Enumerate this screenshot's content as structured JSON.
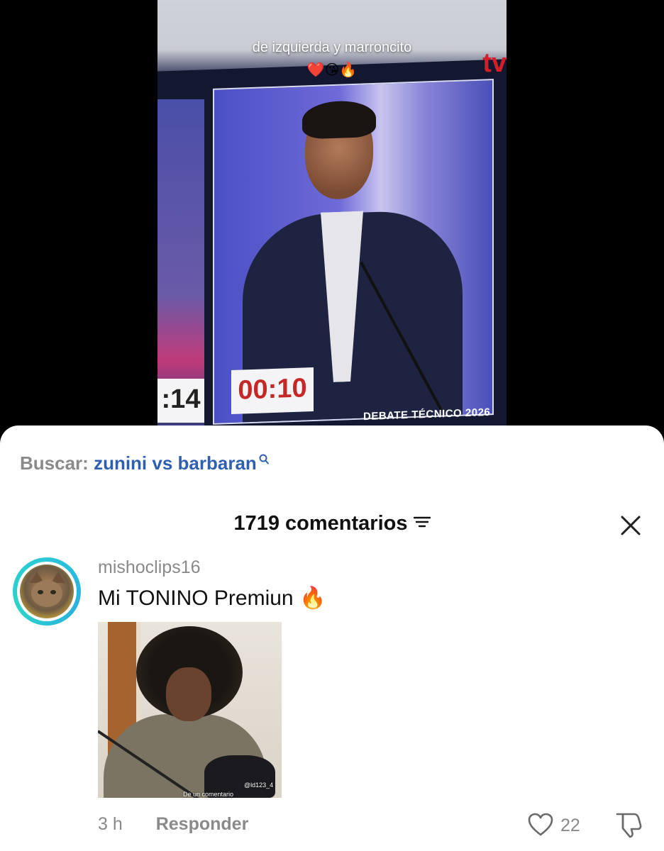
{
  "video": {
    "overlay_caption": "de izquierda y marroncito",
    "overlay_emojis": "❤️😘🔥",
    "channel_logo": "tv",
    "timer_left": ":14",
    "timer_main": "00:10",
    "banner": "DEBATE TÉCNICO 2026"
  },
  "search": {
    "prefix": "Buscar:",
    "term": "zunini vs barbaran",
    "icon": "search-icon"
  },
  "comments_panel": {
    "header": "1719 comentarios",
    "filter_icon": "filter-icon",
    "close_icon": "close-icon"
  },
  "comment": {
    "username": "mishoclips16",
    "text": "Mi TONINO Premiun 🔥",
    "image_watermark": "@ld123_4",
    "image_caption": "De un comentario",
    "time": "3 h",
    "reply_label": "Responder",
    "like_count": "22",
    "like_icon": "heart-icon",
    "dislike_icon": "thumbs-down-icon"
  },
  "colors": {
    "search_term": "#2f5fb0",
    "muted_text": "#8a8a8a",
    "avatar_ring": "#2bc7d8",
    "timer_red": "#c62828"
  }
}
